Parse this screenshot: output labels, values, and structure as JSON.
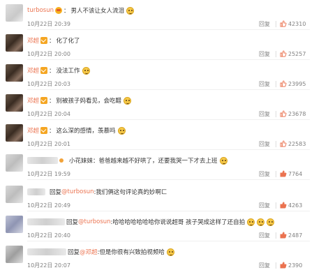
{
  "labels": {
    "reply": "回复",
    "reply_prefix": "回复"
  },
  "colors": {
    "username": "#eb7350",
    "time": "#808080",
    "thumb": "#eb7350"
  },
  "comments": [
    {
      "user": "turbosun",
      "badge": "crown",
      "text": "男人不该让女人流泪",
      "time": "10月22日 20:39",
      "likes": "42310",
      "emoji": true
    },
    {
      "user": "邓超",
      "badge": "v",
      "text": "化了化了",
      "time": "10月22日 20:00",
      "likes": "25257",
      "emoji": false
    },
    {
      "user": "邓超",
      "badge": "v",
      "text": "没法工作",
      "time": "10月22日 20:03",
      "likes": "23995",
      "emoji": true
    },
    {
      "user": "邓超",
      "badge": "v",
      "text": "别被孩子妈看见，会吃醋",
      "time": "10月22日 20:04",
      "likes": "23678",
      "emoji": true
    },
    {
      "user": "邓超",
      "badge": "v",
      "text": "这么深的感情，羡慕吗",
      "time": "10月22日 20:01",
      "likes": "22583",
      "emoji": true
    },
    {
      "user": "",
      "badge": "dot",
      "text": "小花妹妹：爸爸越来越不好哄了，还要我哭一下才去上班",
      "time": "10月22日 19:59",
      "likes": "7764",
      "emoji": true
    },
    {
      "user": "",
      "badge": "none",
      "text_prefix": "回复",
      "mention": "@turbosun",
      "text": ":我们俩这句评论真的妙啊ㄈ",
      "time": "10月22日 20:49",
      "likes": "4263",
      "emoji": false
    },
    {
      "user": "",
      "badge": "none",
      "text_prefix": "回复",
      "mention": "@turbosun",
      "text": ":哈哈哈哈哈哈哈你说说超哥 孩子哭成这样了还自拍",
      "time": "10月22日 20:40",
      "likes": "2487",
      "emoji": true,
      "emoji_count": 3
    },
    {
      "user": "",
      "badge": "none",
      "text_prefix": "回复",
      "mention": "@邓超",
      "text": ":但是你很有兴致拍视频哈",
      "time": "10月22日 20:07",
      "likes": "2390",
      "emoji": true
    }
  ]
}
